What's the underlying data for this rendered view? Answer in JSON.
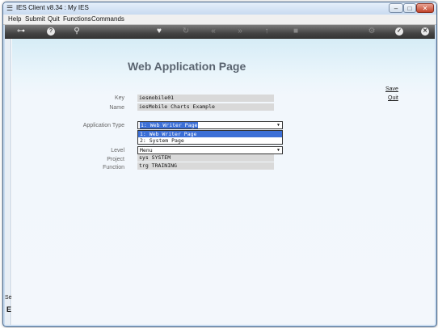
{
  "window": {
    "title": "IES Client v8.34 : My IES",
    "controls": {
      "minimize": "–",
      "maximize": "□",
      "close": "✕"
    }
  },
  "menu": [
    "Help",
    "Submit",
    "Quit",
    "Functions",
    "Commands"
  ],
  "toolbar": {
    "icons": [
      "key-icon",
      "help-icon",
      "search-icon",
      "favorite-icon",
      "refresh-icon",
      "back-icon",
      "forward-icon",
      "up-icon",
      "stop-icon",
      "settings-icon",
      "ok-icon",
      "close-icon"
    ]
  },
  "sidebar": {
    "text": "Sei",
    "mark": "E"
  },
  "page": {
    "title": "Web Application Page",
    "save_link": "Save",
    "quit_link": "Quit"
  },
  "form": {
    "key_label": "Key",
    "key_value": "iesmobile01",
    "name_label": "Name",
    "name_value": "iesMobile Charts Example",
    "app_type_label": "Application Type",
    "app_type_value": "1: Web Writer Page",
    "app_type_options": [
      "1: Web Writer Page",
      "2: System Page"
    ],
    "level_label": "Level",
    "level_value": "Menu",
    "project_label": "Project",
    "project_value": "sys SYSTEM",
    "function_label": "Function",
    "function_value": "trg TRAINING"
  }
}
